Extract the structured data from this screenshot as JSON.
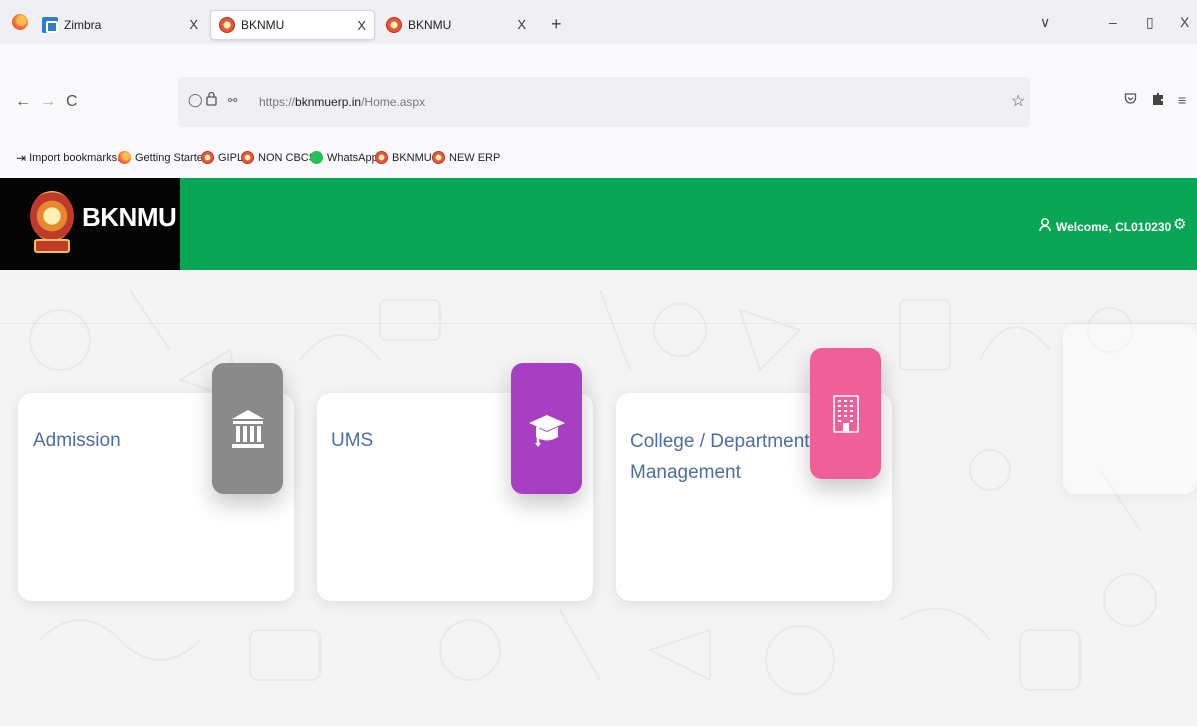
{
  "browser": {
    "tabs": [
      {
        "title": "Zimbra",
        "close": "X",
        "active": false
      },
      {
        "title": "BKNMU",
        "close": "X",
        "active": true
      },
      {
        "title": "BKNMU",
        "close": "X",
        "active": false
      }
    ],
    "new_tab": "+",
    "window_controls": {
      "list": "∨",
      "minimize": "–",
      "maximize": "▯",
      "close": "X"
    },
    "nav": {
      "back": "←",
      "forward": "→",
      "reload": "C"
    },
    "url": {
      "prefix": "https://",
      "domain": "bknmuerp.in",
      "path": "/Home.aspx"
    },
    "bookmarks": [
      {
        "label": "Import bookmarks...",
        "icon": "import-icon"
      },
      {
        "label": "Getting Started",
        "icon": "firefox-icon"
      },
      {
        "label": "GIPL",
        "icon": "bknmu-favicon"
      },
      {
        "label": "NON CBCS",
        "icon": "bknmu-favicon"
      },
      {
        "label": "WhatsApp",
        "icon": "whatsapp-icon"
      },
      {
        "label": "BKNMU",
        "icon": "bknmu-favicon"
      },
      {
        "label": "NEW ERP",
        "icon": "bknmu-favicon"
      }
    ]
  },
  "header": {
    "brand": "BKNMU",
    "welcome": "Welcome, CL010230",
    "colors": {
      "bar": "#0aa655",
      "brand_bg": "#050505"
    }
  },
  "modules": [
    {
      "title": "Admission",
      "icon": "bank-building-icon",
      "color": "#8a8a8a"
    },
    {
      "title": "UMS",
      "icon": "graduation-cap-icon",
      "color": "#a83ec1"
    },
    {
      "title": "College / Department Management",
      "title_line1": "College / Department",
      "title_line2": "Management",
      "icon": "office-building-icon",
      "color": "#ef5f98"
    }
  ]
}
